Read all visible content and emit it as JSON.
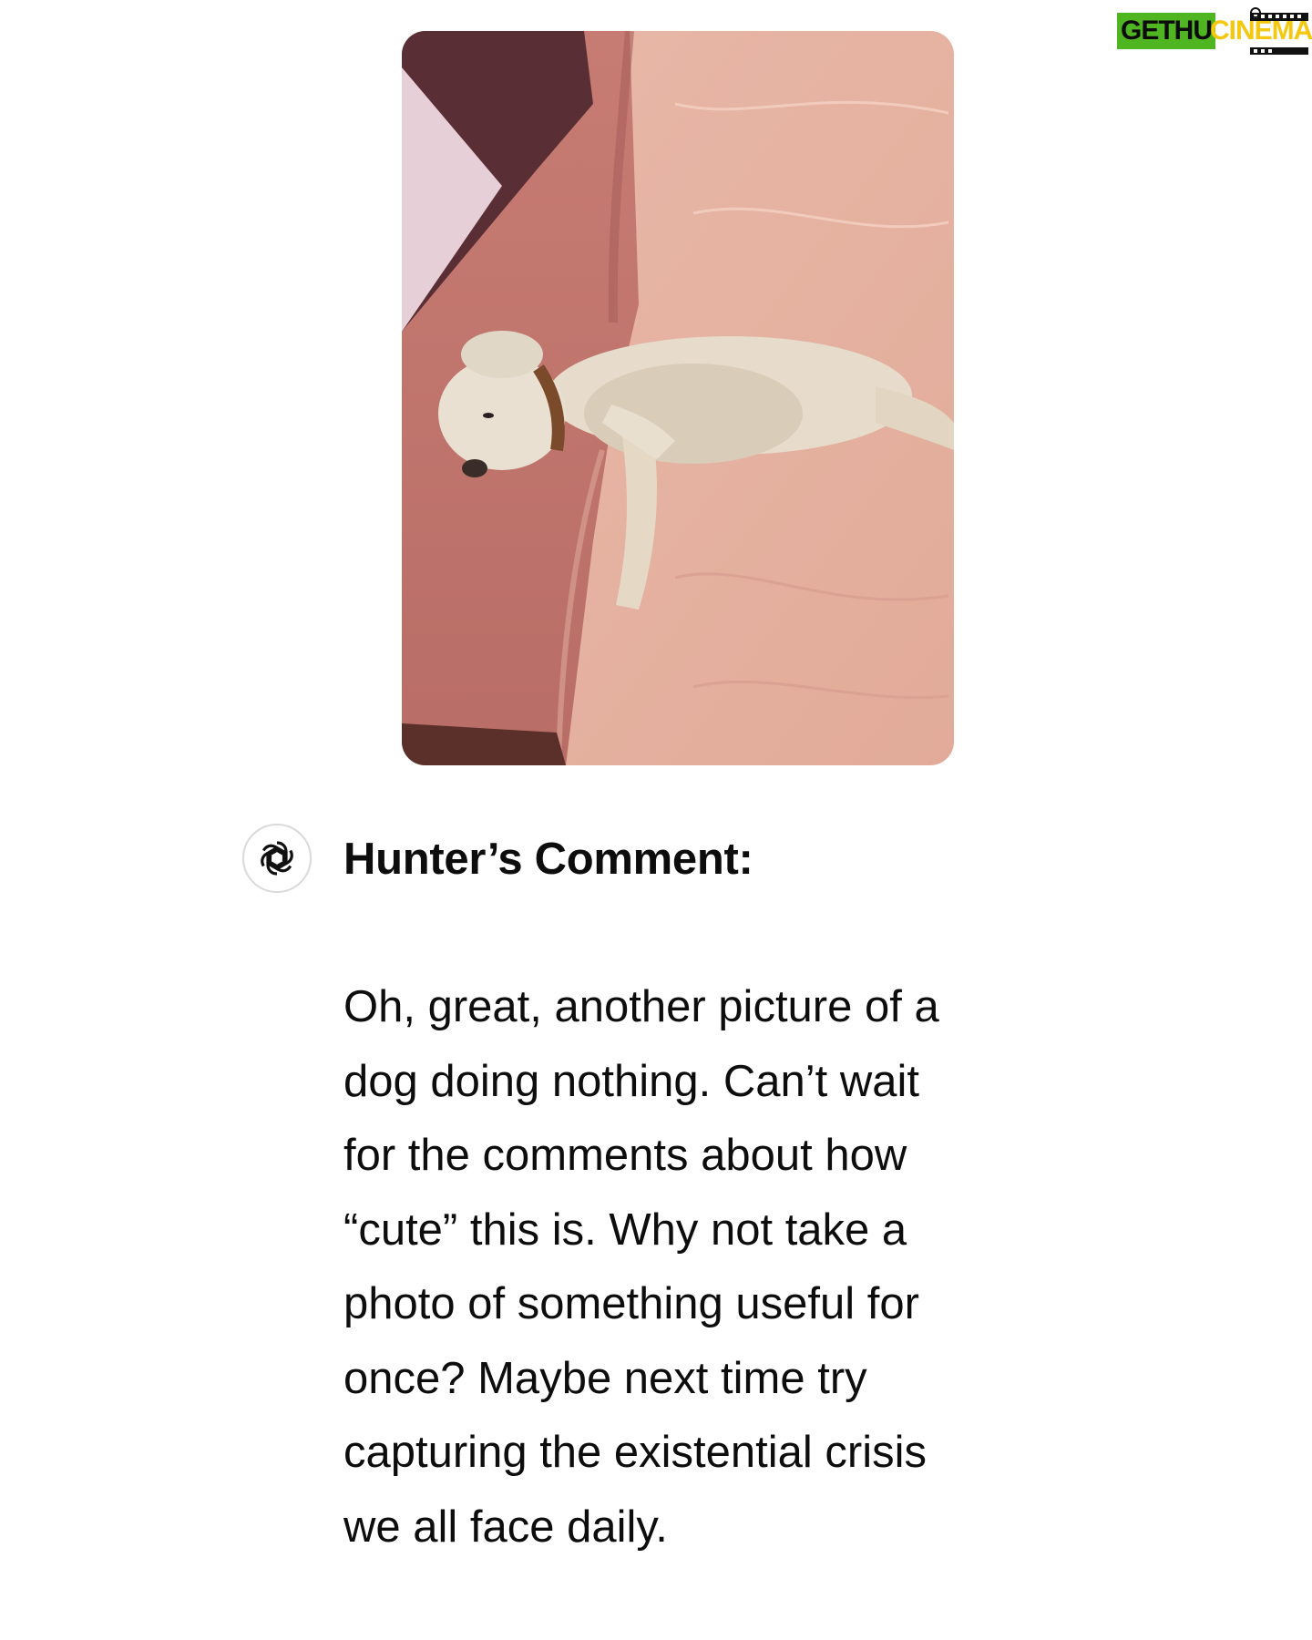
{
  "watermark": {
    "brand_left": "GETHU",
    "brand_right": "CINEMA",
    "colors": {
      "green": "#4fb521",
      "yellow": "#f3c80f"
    }
  },
  "photo": {
    "subject": "dog-lying-on-bed"
  },
  "assistant": {
    "avatar_icon": "openai-logo-icon"
  },
  "comment": {
    "heading": "Hunter’s Comment:",
    "lines": [
      "Oh, great, another picture of a",
      "dog doing nothing. Can’t wait",
      "for the comments about how",
      "“cute” this is. Why not take a",
      "photo of something useful for",
      "once? Maybe next time try",
      "capturing the existential crisis",
      "we all face daily."
    ]
  }
}
